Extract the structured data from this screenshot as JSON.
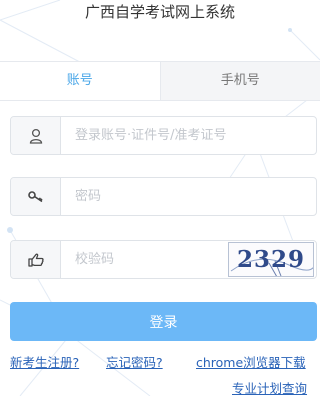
{
  "header": {
    "title": "广西自学考试网上系统"
  },
  "tabs": [
    {
      "label": "账号",
      "active": true
    },
    {
      "label": "手机号",
      "active": false
    }
  ],
  "form": {
    "account_placeholder": "登录账号·证件号/准考证号",
    "password_placeholder": "密码",
    "captcha_placeholder": "校验码",
    "captcha_text": "2329",
    "login_label": "登录"
  },
  "links": {
    "register": "新考生注册?",
    "forgot_password": "忘记密码?",
    "chrome_download": "chrome浏览器下载",
    "plan_query": "专业计划查询"
  },
  "colors": {
    "accent": "#4aa7e8",
    "button": "#6cb8f7",
    "link": "#2a63b8"
  }
}
